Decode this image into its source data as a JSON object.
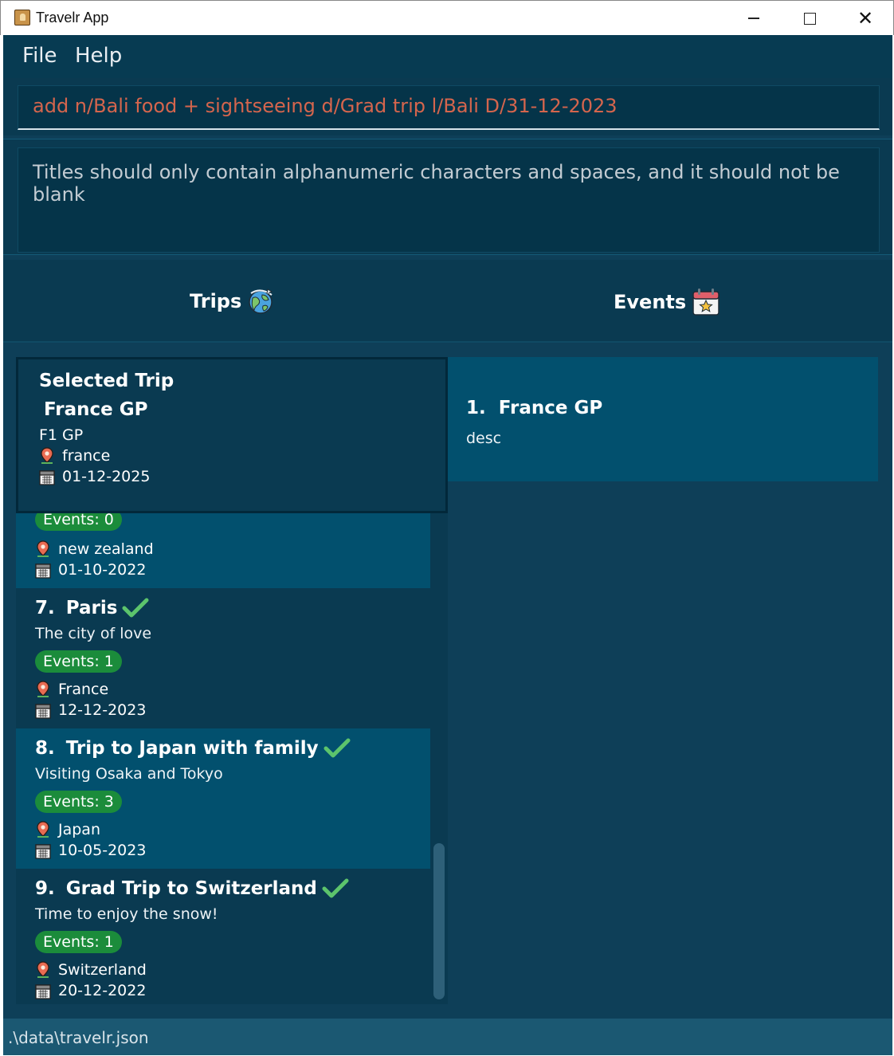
{
  "window": {
    "title": "Travelr App"
  },
  "menu": {
    "file": "File",
    "help": "Help"
  },
  "command": {
    "value": "add n/Bali food + sightseeing d/Grad trip l/Bali D/31-12-2023"
  },
  "result": {
    "message": "Titles should only contain alphanumeric characters and spaces, and it should not be blank"
  },
  "tabs": {
    "trips": "Trips",
    "events": "Events"
  },
  "selected_trip": {
    "heading": "Selected Trip",
    "title": "France GP",
    "description": "F1 GP",
    "location": "france",
    "date": "01-12-2025"
  },
  "trips": [
    {
      "events": "Events: 0",
      "location": "new zealand",
      "date": "01-10-2022"
    },
    {
      "index": "7.",
      "title": "Paris",
      "description": "The city of love",
      "events": "Events: 1",
      "location": "France",
      "date": "12-12-2023"
    },
    {
      "index": "8.",
      "title": "Trip to Japan with family",
      "description": "Visiting Osaka and Tokyo",
      "events": "Events: 3",
      "location": "Japan",
      "date": "10-05-2023"
    },
    {
      "index": "9.",
      "title": "Grad Trip to Switzerland",
      "description": "Time to enjoy the snow!",
      "events": "Events: 1",
      "location": "Switzerland",
      "date": "20-12-2022"
    }
  ],
  "events": [
    {
      "index": "1.",
      "title": "France GP",
      "description": "desc"
    }
  ],
  "status": {
    "path": ".\\data\\travelr.json"
  },
  "colors": {
    "badge": "#1b8c3b",
    "check": "#5cc46c",
    "command_text": "#d5654d",
    "background": "#0e3f58"
  }
}
